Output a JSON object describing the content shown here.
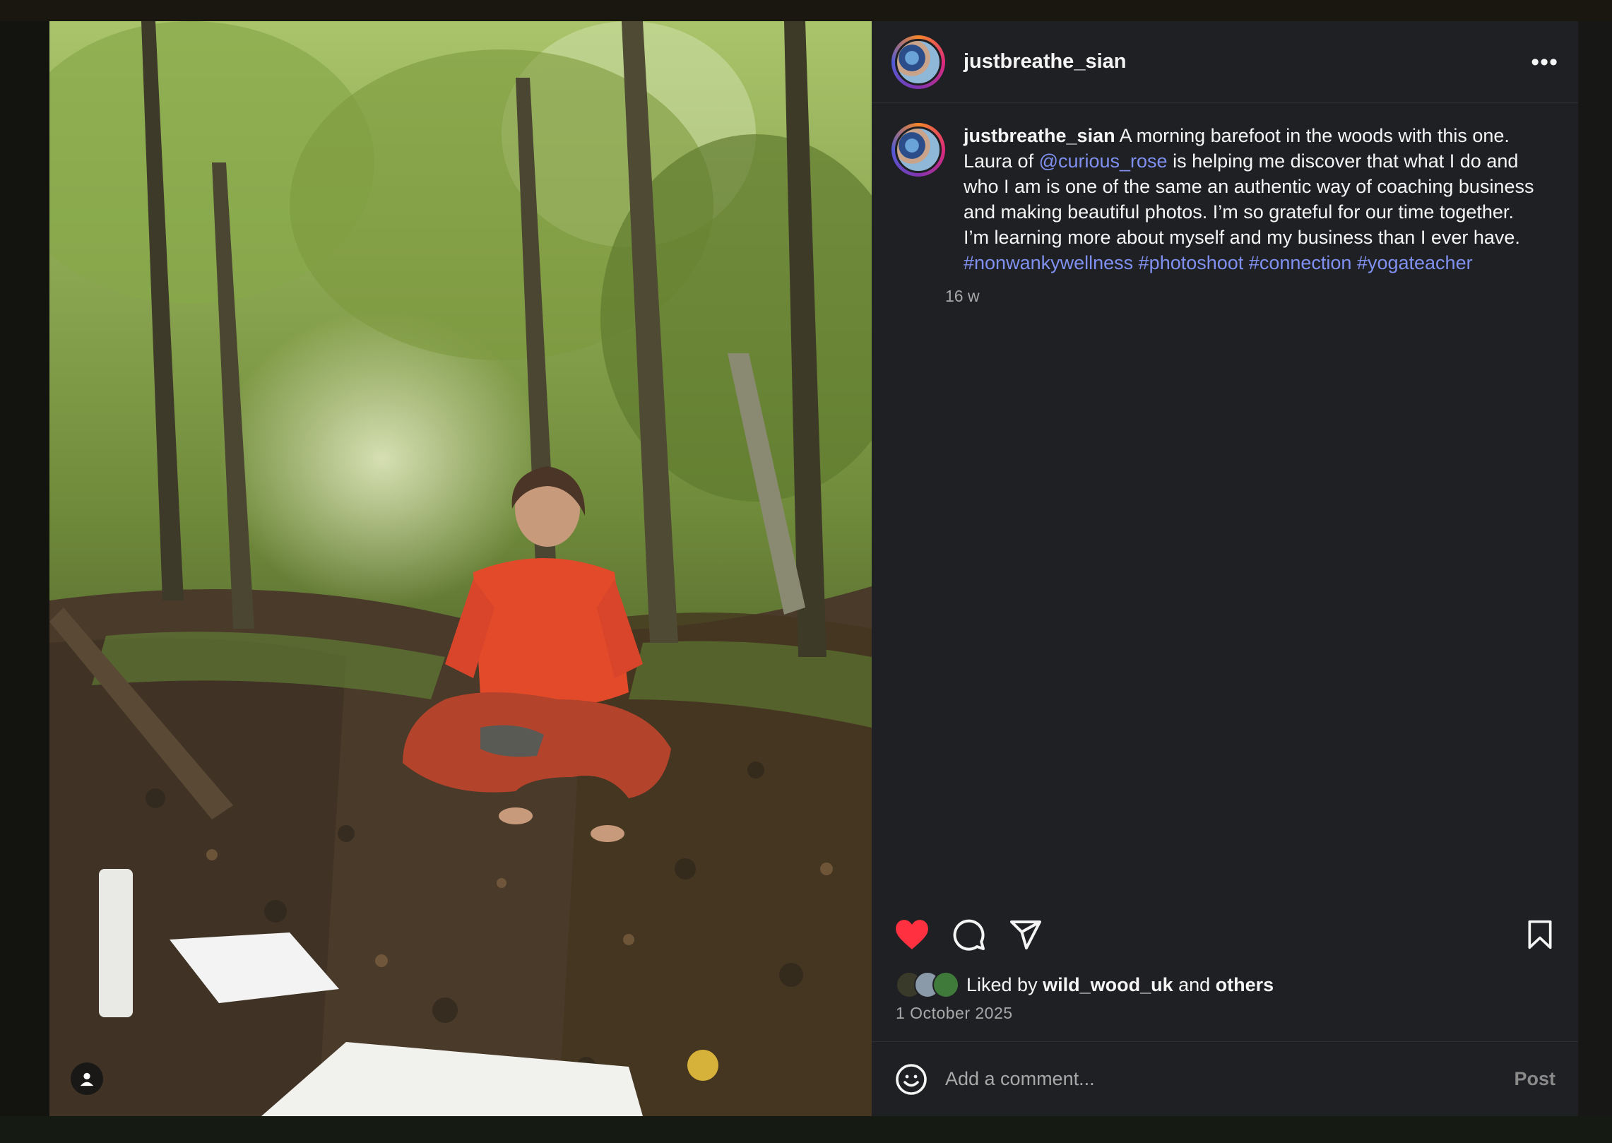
{
  "post": {
    "username": "justbreathe_sian",
    "more_label": "•••",
    "caption": {
      "username": "justbreathe_sian",
      "line1": " A morning barefoot in the woods with this one.",
      "line2_prefix": "Laura of ",
      "mention": "@curious_rose",
      "line2_rest": " is helping me discover that what I do and who I am is one of the same an authentic way of coaching business and making beautiful photos. I’m so grateful for our time together. I’m learning more about myself and my business than I ever have. ",
      "hashtags": [
        "#nonwankywellness",
        "#photoshoot",
        "#connection",
        "#yogateacher"
      ]
    },
    "time_ago": "16 w",
    "liked_by_prefix": "Liked by ",
    "liked_by_user": "wild_wood_uk",
    "liked_by_and": " and ",
    "liked_by_others": "others",
    "date": "1 October 2025",
    "comment_placeholder": "Add a comment...",
    "post_label": "Post"
  },
  "colors": {
    "link": "#8090f0",
    "heart": "#ff3040",
    "panel": "#1f2024"
  },
  "icons": [
    "heart-icon",
    "comment-icon",
    "share-icon",
    "bookmark-icon",
    "emoji-icon",
    "user-tag-icon",
    "more-icon"
  ]
}
